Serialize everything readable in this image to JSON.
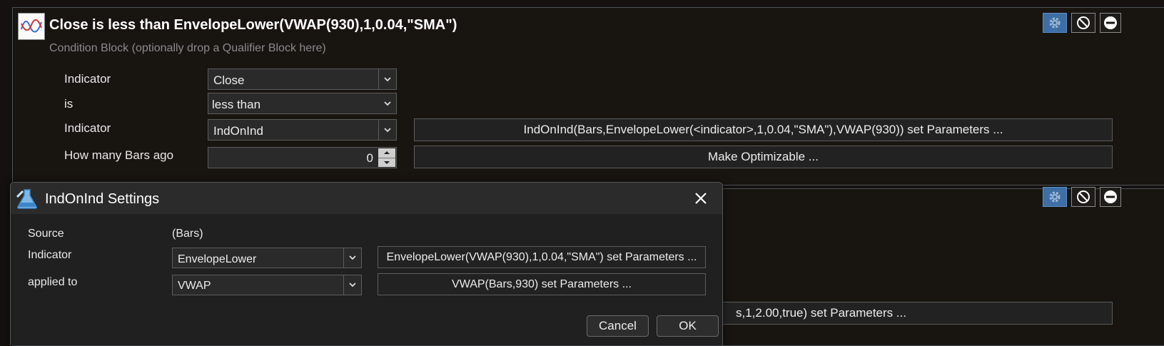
{
  "block1": {
    "title": "Close is less than EnvelopeLower(VWAP(930),1,0.04,\"SMA\")",
    "subtitle": "Condition Block (optionally drop a Qualifier Block here)",
    "rows": [
      {
        "label": "Indicator",
        "value": "Close"
      },
      {
        "label": "is",
        "value": "less than"
      },
      {
        "label": "Indicator",
        "value": "IndOnInd",
        "button": "IndOnInd(Bars,EnvelopeLower(<indicator>,1,0.04,\"SMA\"),VWAP(930)) set Parameters ..."
      },
      {
        "label": "How many Bars ago",
        "value": "0",
        "button": "Make Optimizable ..."
      }
    ],
    "icons": [
      "gear-icon",
      "disable-icon",
      "remove-icon"
    ]
  },
  "block2": {
    "partial_button": "s,1,2.00,true) set Parameters ..."
  },
  "dialog": {
    "title": "IndOnInd Settings",
    "rows": [
      {
        "label": "Source",
        "value": "(Bars)"
      },
      {
        "label": "Indicator",
        "value": "EnvelopeLower",
        "button": "EnvelopeLower(VWAP(930),1,0.04,\"SMA\") set Parameters ..."
      },
      {
        "label": "applied to",
        "value": "VWAP",
        "button": "VWAP(Bars,930) set Parameters ..."
      }
    ],
    "cancel_label": "Cancel",
    "ok_label": "OK"
  },
  "colors": {
    "background": "#141110",
    "panel": "#181511",
    "accent": "#3e6ea4",
    "dialog": "#202020"
  }
}
